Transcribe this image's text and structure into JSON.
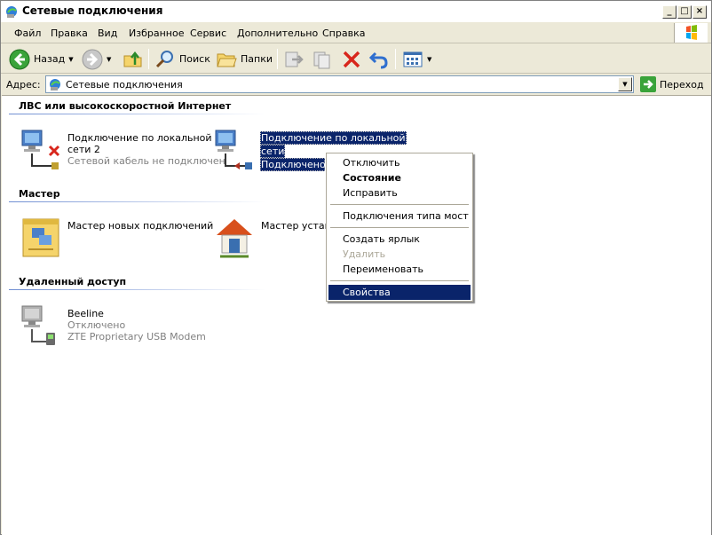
{
  "window": {
    "title": "Сетевые подключения"
  },
  "menu": {
    "items": [
      "Файл",
      "Правка",
      "Вид",
      "Избранное",
      "Сервис",
      "Дополнительно",
      "Справка"
    ]
  },
  "toolbar": {
    "back": "Назад",
    "search": "Поиск",
    "folders": "Папки"
  },
  "address": {
    "label": "Адрес:",
    "value": "Сетевые подключения",
    "go": "Переход"
  },
  "groups": {
    "lan": {
      "title": "ЛВС или высокоскоростной Интернет"
    },
    "wizard": {
      "title": "Мастер"
    },
    "remote": {
      "title": "Удаленный доступ"
    }
  },
  "items": {
    "lan2": {
      "name_line1": "Подключение по локальной",
      "name_line2": "сети 2",
      "status": "Сетевой кабель не подключен"
    },
    "lan1": {
      "name_line1": "Подключение по локальной",
      "name_line2": "сети",
      "status": "Подключено,"
    },
    "wiz_new": {
      "name": "Мастер новых подключений"
    },
    "wiz_home": {
      "name": "Мастер устано"
    },
    "beeline": {
      "name": "Beeline",
      "status": "Отключено",
      "device": "ZTE Proprietary USB Modem"
    }
  },
  "context_menu": {
    "disconnect": "Отключить",
    "status": "Состояние",
    "repair": "Исправить",
    "bridge": "Подключения типа мост",
    "shortcut": "Создать ярлык",
    "delete": "Удалить",
    "rename": "Переименовать",
    "properties": "Свойства"
  },
  "colors": {
    "selection": "#0a246a",
    "chrome": "#ece9d8",
    "group_line": "#6f8ed2",
    "disabled": "#aca899"
  }
}
